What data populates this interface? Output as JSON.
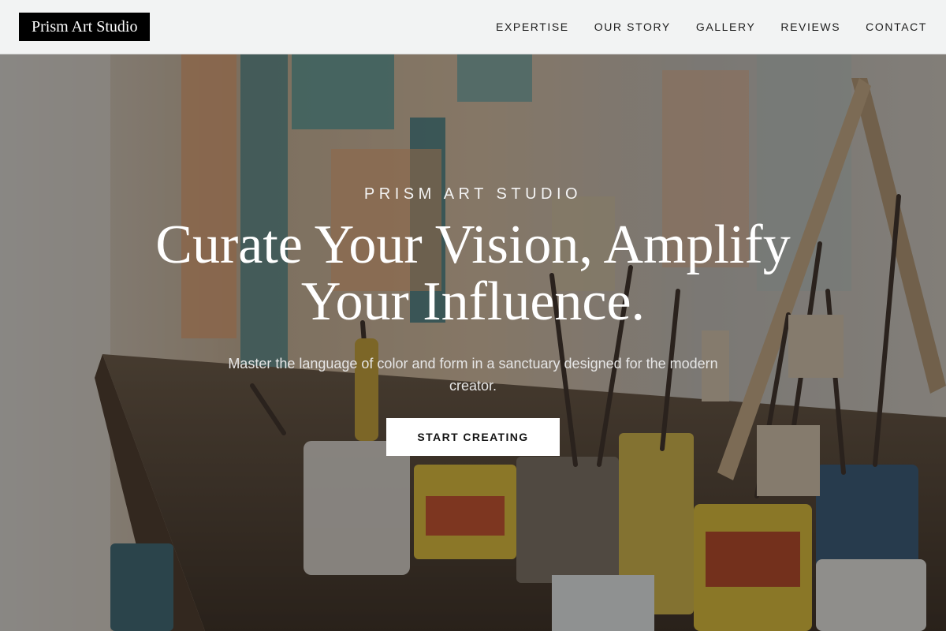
{
  "header": {
    "logo_text": "Prism Art Studio",
    "nav": [
      {
        "label": "EXPERTISE"
      },
      {
        "label": "OUR STORY"
      },
      {
        "label": "GALLERY"
      },
      {
        "label": "REVIEWS"
      },
      {
        "label": "CONTACT"
      }
    ]
  },
  "hero": {
    "kicker": "PRISM ART STUDIO",
    "headline": "Curate Your Vision, Amplify Your Influence.",
    "subtitle": "Master the language of color and form in a sanctuary designed for the modern creator.",
    "cta_label": "START CREATING",
    "background_image": "art-studio-paint-supplies-photo"
  },
  "colors": {
    "header_bg": "#f2f3f3",
    "logo_bg": "#000000",
    "cta_bg": "#ffffff",
    "text_light": "#ffffff"
  }
}
